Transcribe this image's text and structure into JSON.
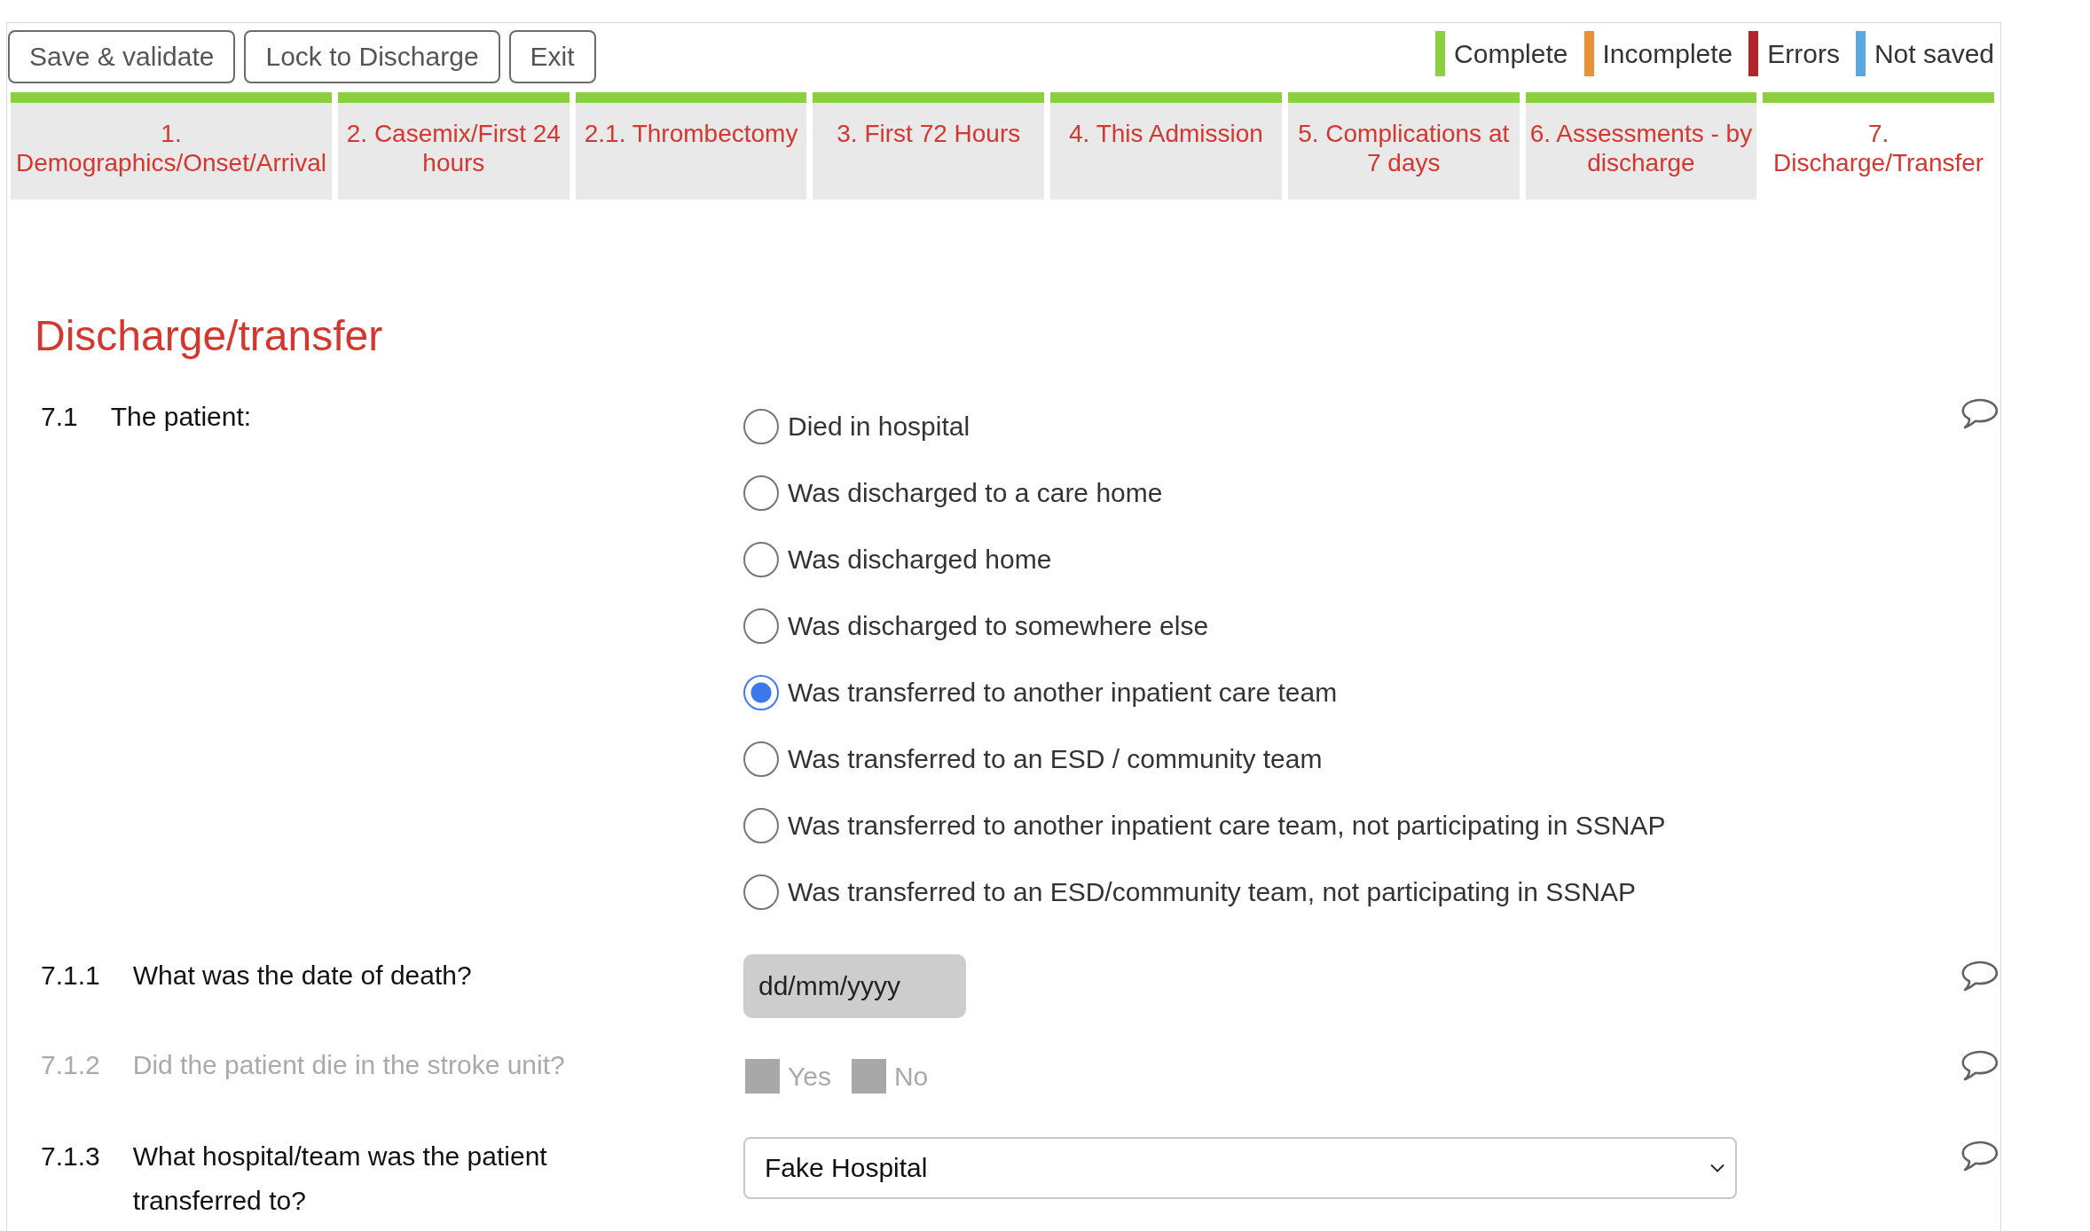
{
  "toolbar": {
    "buttons": [
      {
        "label": "Save & validate"
      },
      {
        "label": "Lock to Discharge"
      },
      {
        "label": "Exit"
      }
    ]
  },
  "legend": [
    {
      "label": "Complete",
      "color": "#8ccf3f"
    },
    {
      "label": "Incomplete",
      "color": "#e8903a"
    },
    {
      "label": "Errors",
      "color": "#b3232b"
    },
    {
      "label": "Not saved",
      "color": "#5aa8dd"
    }
  ],
  "tabs": [
    {
      "label": "1. Demographics/Onset/Arrival",
      "color": "#8ccf3f",
      "selected": false
    },
    {
      "label": "2. Casemix/First 24 hours",
      "color": "#8ccf3f",
      "selected": false
    },
    {
      "label": "2.1. Thrombectomy",
      "color": "#8ccf3f",
      "selected": false
    },
    {
      "label": "3. First 72 Hours",
      "color": "#8ccf3f",
      "selected": false
    },
    {
      "label": "4. This Admission",
      "color": "#8ccf3f",
      "selected": false
    },
    {
      "label": "5. Complications at 7 days",
      "color": "#8ccf3f",
      "selected": false
    },
    {
      "label": "6. Assessments - by discharge",
      "color": "#8ccf3f",
      "selected": false
    },
    {
      "label": "7. Discharge/Transfer",
      "color": "#8ccf3f",
      "selected": true
    }
  ],
  "section": {
    "title": "Discharge/transfer",
    "questions": [
      {
        "kind": "radio",
        "number": "7.1",
        "label": "The patient:",
        "disabled": false,
        "options": [
          {
            "label": "Died in hospital",
            "selected": false
          },
          {
            "label": "Was discharged to a care home",
            "selected": false
          },
          {
            "label": "Was discharged home",
            "selected": false
          },
          {
            "label": "Was discharged to somewhere else",
            "selected": false
          },
          {
            "label": "Was transferred to another inpatient care team",
            "selected": true
          },
          {
            "label": "Was transferred to an ESD / community team",
            "selected": false
          },
          {
            "label": "Was transferred to another inpatient care team, not participating in SSNAP",
            "selected": false
          },
          {
            "label": "Was transferred to an ESD/community team, not participating in SSNAP",
            "selected": false
          }
        ]
      },
      {
        "kind": "date",
        "number": "7.1.1",
        "label": "What was the date of death?",
        "disabled": false,
        "placeholder": "dd/mm/yyyy"
      },
      {
        "kind": "checkbox",
        "number": "7.1.2",
        "label": "Did the patient die in the stroke unit?",
        "disabled": true,
        "options": [
          {
            "label": "Yes",
            "checked": false
          },
          {
            "label": "No",
            "checked": false
          }
        ]
      },
      {
        "kind": "select",
        "number": "7.1.3",
        "label": "What hospital/team was the patient transferred to?",
        "disabled": false,
        "value": "Fake Hospital"
      }
    ]
  }
}
